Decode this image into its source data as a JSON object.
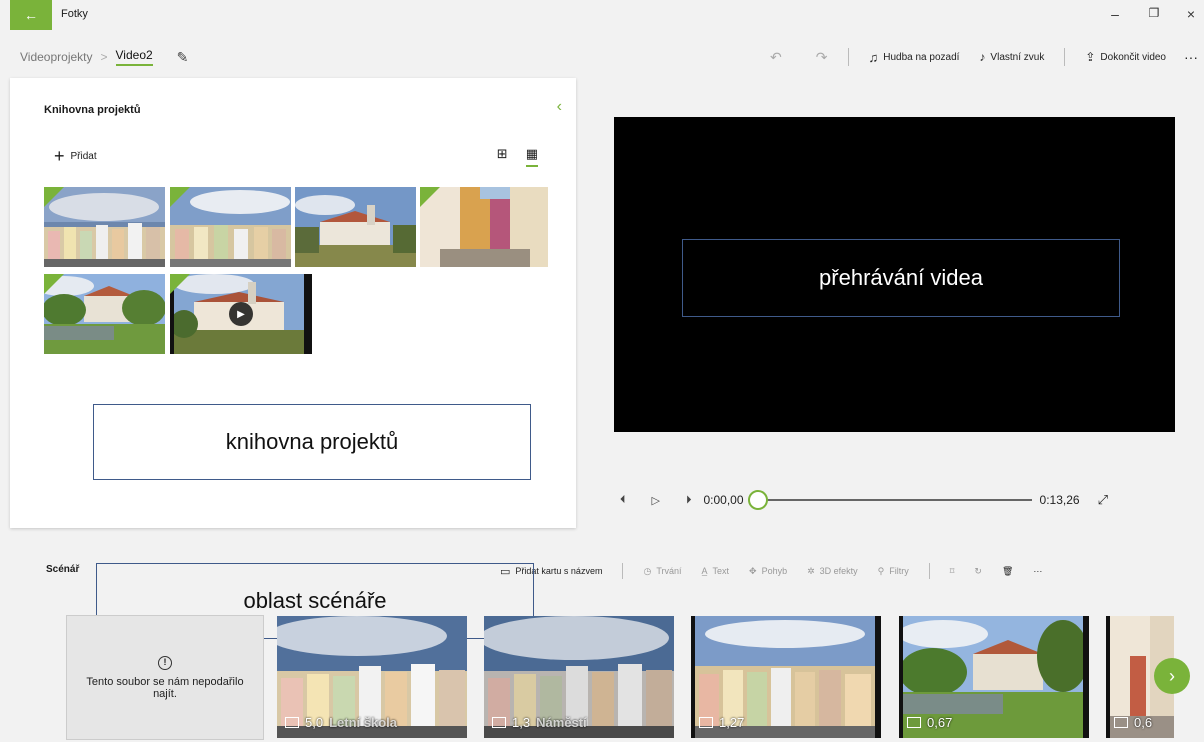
{
  "app": {
    "title": "Fotky",
    "back_icon": "←"
  },
  "window_controls": {
    "minimize": "–",
    "restore": "❐",
    "close": "×"
  },
  "breadcrumb": {
    "root": "Videoprojekty",
    "separator": ">",
    "current": "Video2"
  },
  "toolbar": {
    "music_label": "Hudba na pozadí",
    "custom_audio_label": "Vlastní zvuk",
    "finish_label": "Dokončit video",
    "more": "···"
  },
  "library": {
    "title": "Knihovna projektů",
    "add_label": "Přidat",
    "collapse_icon": "‹"
  },
  "annotations": {
    "library": "knihovna projektů",
    "video": "přehrávání videa",
    "storyboard": "oblast scénáře"
  },
  "player": {
    "time_start": "0:00,00",
    "time_end": "0:13,26",
    "progress": 0
  },
  "storyboard": {
    "title": "Scénář",
    "add_title_card": "Přidat kartu s názvem",
    "duration": "Trvání",
    "text": "Text",
    "motion": "Pohyb",
    "effects3d": "3D efekty",
    "filters": "Filtry",
    "more": "···",
    "missing_text": "Tento soubor se nám nepodařilo najít.",
    "clips": [
      {
        "duration": "5,0",
        "caption": "Letní škola"
      },
      {
        "duration": "1,3",
        "caption": "Náměstí"
      },
      {
        "duration": "1,27",
        "caption": ""
      },
      {
        "duration": "0,67",
        "caption": ""
      },
      {
        "duration": "0,6",
        "caption": ""
      }
    ],
    "next_icon": "›"
  },
  "colors": {
    "accent": "#7ab33a",
    "annotation_border": "#3f5a8a",
    "preview_bg": "#000000"
  }
}
